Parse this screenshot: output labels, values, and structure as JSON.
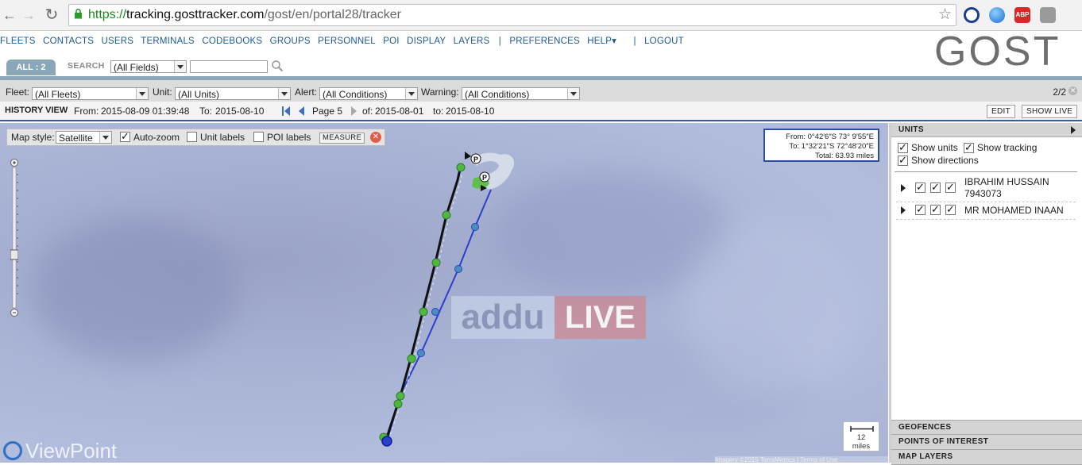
{
  "browser": {
    "url_scheme": "https://",
    "url_host": "tracking.gosttracker.com",
    "url_path": "/gost/en/portal28/tracker"
  },
  "nav": {
    "items": [
      "FLEETS",
      "CONTACTS",
      "USERS",
      "TERMINALS",
      "CODEBOOKS",
      "GROUPS",
      "PERSONNEL",
      "POI",
      "DISPLAY",
      "LAYERS"
    ],
    "preferences": "PREFERENCES",
    "help": "HELP▾",
    "logout": "LOGOUT",
    "logo": "GOST"
  },
  "search": {
    "tab_label": "ALL : 2",
    "label": "SEARCH",
    "field_select": "(All Fields)",
    "query": ""
  },
  "filters": {
    "fleet_label": "Fleet:",
    "fleet_value": "(All Fleets)",
    "unit_label": "Unit:",
    "unit_value": "(All Units)",
    "alert_label": "Alert:",
    "alert_value": "(All Conditions)",
    "warning_label": "Warning:",
    "warning_value": "(All Conditions)",
    "count": "2/2"
  },
  "history": {
    "title": "HISTORY VIEW",
    "from_label": "From:",
    "from_value": "2015-08-09 01:39:48",
    "to_label": "To:",
    "to_value": "2015-08-10",
    "page_label": "Page 5",
    "of_label": "of:",
    "of_value": "2015-08-01",
    "to2_label": "to:",
    "to2_value": "2015-08-10",
    "edit_btn": "EDIT",
    "showlive_btn": "SHOW LIVE"
  },
  "map": {
    "style_label": "Map style:",
    "style_value": "Satellite",
    "autozoom_label": "Auto-zoom",
    "autozoom_checked": true,
    "unit_labels_label": "Unit labels",
    "unit_labels_checked": false,
    "poi_labels_label": "POI labels",
    "poi_labels_checked": false,
    "measure_btn": "MEASURE",
    "coords_from": "From: 0°42′6″S  73° 9′55″E",
    "coords_to": "To:  1°32′21″S  72°48′20″E",
    "coords_total": "Total: 63.93 miles",
    "scale_value": "12",
    "scale_unit": "miles",
    "watermark_left": "addu",
    "watermark_right": "LIVE",
    "provider_logo": "ViewPoint",
    "terms_text": "Imagery ©2015 TerraMetrics  |  Terms of Use"
  },
  "units_panel": {
    "header": "UNITS",
    "show_units_label": "Show units",
    "show_tracking_label": "Show tracking",
    "show_directions_label": "Show directions",
    "units": [
      {
        "name_line1": "IBRAHIM HUSSAIN",
        "name_line2": "7943073"
      },
      {
        "name_line1": "MR MOHAMED INAAN",
        "name_line2": ""
      }
    ],
    "geofences_header": "GEOFENCES",
    "poi_header": "POINTS OF INTEREST",
    "layers_header": "MAP LAYERS"
  },
  "colors": {
    "accent_blue": "#1b5a9a",
    "tab_blue": "#8aa7b7",
    "track_black": "#111111",
    "track_blue": "#2a3fd0",
    "point_green": "#4fb843"
  },
  "icons": [
    "back-arrow-icon",
    "forward-arrow-icon",
    "reload-icon",
    "lock-icon",
    "bookmark-star-icon",
    "block-icon",
    "globe-icon",
    "adblock-icon",
    "extension-icon",
    "search-icon",
    "first-page-icon",
    "prev-page-icon",
    "next-page-icon",
    "close-icon",
    "expand-arrow-icon"
  ]
}
